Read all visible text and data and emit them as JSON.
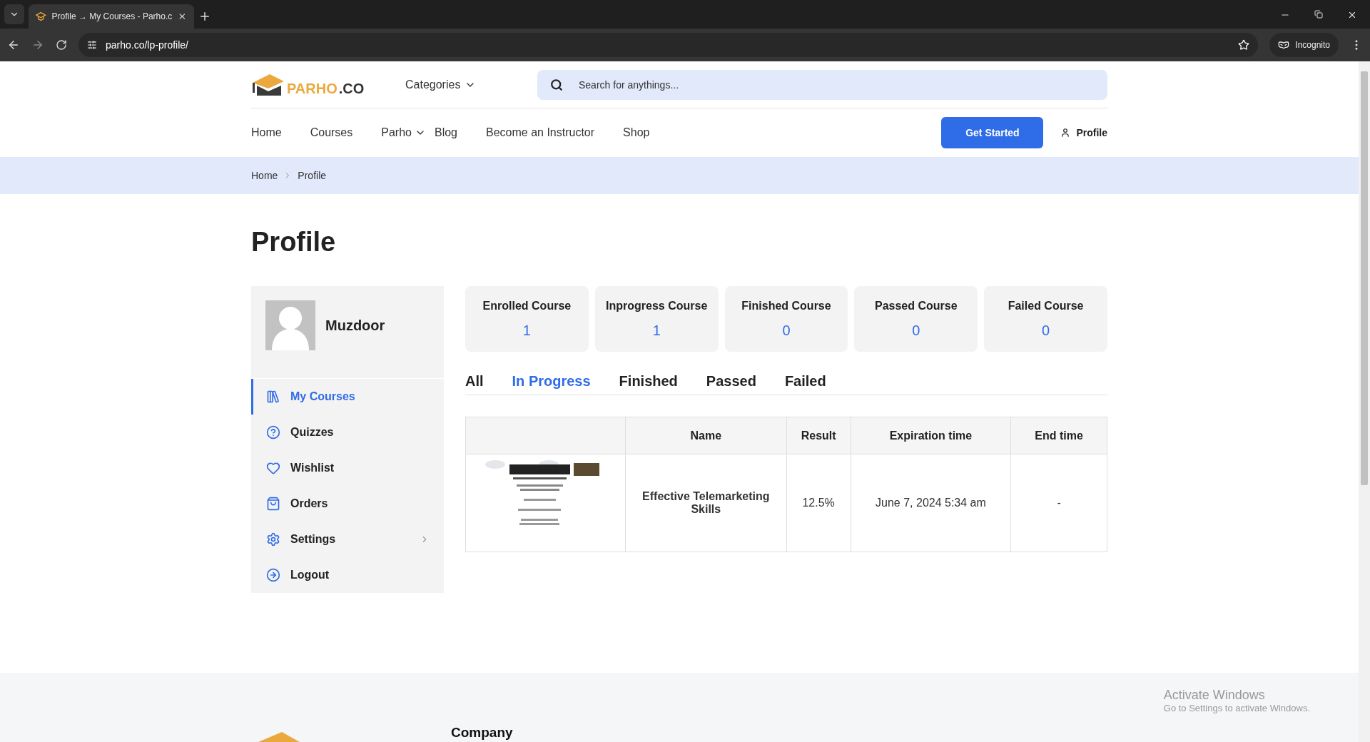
{
  "browser": {
    "tab_title": "Profile → My Courses - Parho.c",
    "url": "parho.co/lp-profile/",
    "incognito_label": "Incognito"
  },
  "header": {
    "logo": {
      "brand": "PARHO",
      "suffix": ".CO"
    },
    "categories": "Categories",
    "search": {
      "placeholder": "Search for anythings..."
    },
    "nav": [
      {
        "label": "Home",
        "dropdown": false
      },
      {
        "label": "Courses",
        "dropdown": false
      },
      {
        "label": "Parho",
        "dropdown": true
      },
      {
        "label": "Blog",
        "dropdown": false
      },
      {
        "label": "Become an Instructor",
        "dropdown": false
      },
      {
        "label": "Shop",
        "dropdown": false
      }
    ],
    "cta": "Get Started",
    "profile_link": "Profile"
  },
  "breadcrumb": [
    "Home",
    "Profile"
  ],
  "page_title": "Profile",
  "sidebar": {
    "user_name": "Muzdoor",
    "items": [
      {
        "label": "My Courses",
        "selected": true,
        "expandable": false
      },
      {
        "label": "Quizzes",
        "selected": false,
        "expandable": false
      },
      {
        "label": "Wishlist",
        "selected": false,
        "expandable": false
      },
      {
        "label": "Orders",
        "selected": false,
        "expandable": false
      },
      {
        "label": "Settings",
        "selected": false,
        "expandable": true
      },
      {
        "label": "Logout",
        "selected": false,
        "expandable": false
      }
    ]
  },
  "stats": [
    {
      "label": "Enrolled Course",
      "value": "1"
    },
    {
      "label": "Inprogress Course",
      "value": "1"
    },
    {
      "label": "Finished Course",
      "value": "0"
    },
    {
      "label": "Passed Course",
      "value": "0"
    },
    {
      "label": "Failed Course",
      "value": "0"
    }
  ],
  "tabs": [
    {
      "label": "All",
      "selected": false
    },
    {
      "label": "In Progress",
      "selected": true
    },
    {
      "label": "Finished",
      "selected": false
    },
    {
      "label": "Passed",
      "selected": false
    },
    {
      "label": "Failed",
      "selected": false
    }
  ],
  "table": {
    "columns": [
      "Name",
      "Result",
      "Expiration time",
      "End time"
    ],
    "rows": [
      {
        "thumbnail": {
          "kind": "picture"
        },
        "cells": [
          "Effective Telemarketing Skills",
          "12.5%",
          "June 7, 2024 5:34 am",
          "-"
        ]
      }
    ]
  },
  "footer": {
    "heading": "Company"
  },
  "os_notice": {
    "title": "Activate Windows",
    "subtitle": "Go to Settings to activate Windows."
  }
}
